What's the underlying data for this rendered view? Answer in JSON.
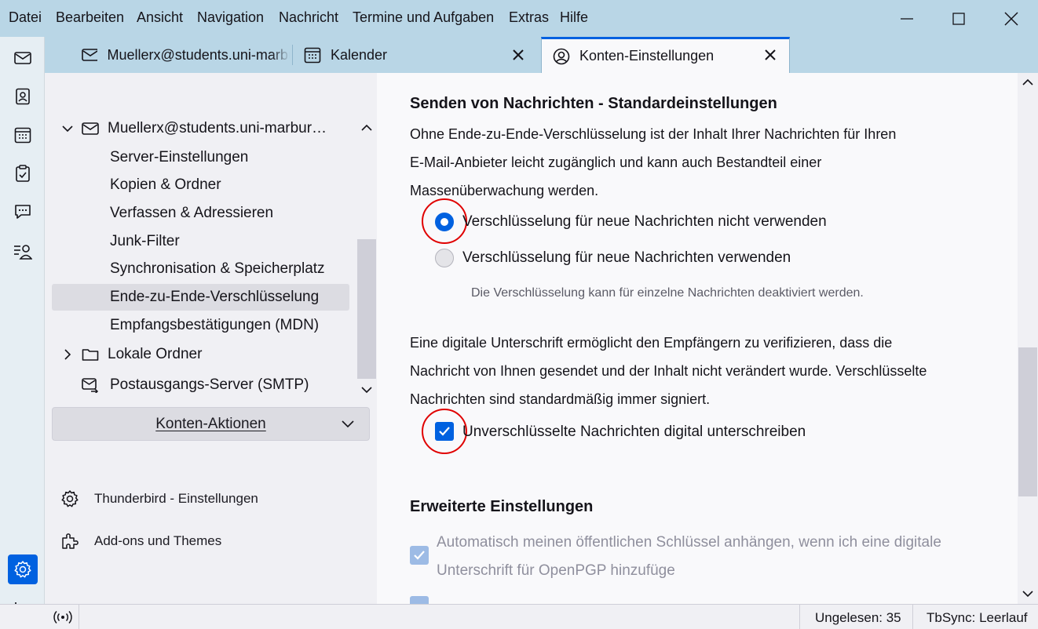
{
  "menubar": {
    "items": [
      "Datei",
      "Bearbeiten",
      "Ansicht",
      "Navigation",
      "Nachricht",
      "Termine und Aufgaben",
      "Extras",
      "Hilfe"
    ]
  },
  "tabs": [
    {
      "label": "Muellerx@students.uni-marburg",
      "icon": "mail-account-icon"
    },
    {
      "label": "Kalender",
      "icon": "calendar-icon"
    },
    {
      "label": "Konten-Einstellungen",
      "icon": "account-settings-icon"
    }
  ],
  "spaces": [
    "mail-icon",
    "address-book-icon",
    "calendar-icon",
    "tasks-icon",
    "chat-icon",
    "tbsync-icon",
    "settings-icon",
    "collapse-icon"
  ],
  "sidebar": {
    "account": "Muellerx@students.uni-marbur…",
    "items": [
      "Server-Einstellungen",
      "Kopien & Ordner",
      "Verfassen & Adressieren",
      "Junk-Filter",
      "Synchronisation & Speicherplatz",
      "Ende-zu-Ende-Verschlüsselung",
      "Empfangsbestätigungen (MDN)"
    ],
    "local_folders": "Lokale Ordner",
    "smtp": "Postausgangs-Server (SMTP)",
    "account_actions": "Konten-Aktionen",
    "settings_link": "Thunderbird - Einstellungen",
    "addons_link": "Add-ons und Themes"
  },
  "content": {
    "section1_title": "Senden von Nachrichten - Standardeinstellungen",
    "section1_text_1": "Ohne Ende-zu-Ende-Verschlüsselung ist der Inhalt Ihrer Nachrichten für Ihren",
    "section1_text_2": "E-Mail-Anbieter leicht zugänglich und kann auch Bestandteil einer",
    "section1_text_3": "Massenüberwachung werden.",
    "radio_no_encryption": "Verschlüsselung für neue Nachrichten nicht verwenden",
    "radio_encryption": "Verschlüsselung für neue Nachrichten verwenden",
    "radio_note": "Die Verschlüsselung kann für einzelne Nachrichten deaktiviert werden.",
    "sign_text_1": "Eine digitale Unterschrift ermöglicht den Empfängern zu verifizieren, dass die",
    "sign_text_2": "Nachricht von Ihnen gesendet und der Inhalt nicht verändert wurde. Verschlüsselte",
    "sign_text_3": "Nachrichten sind standardmäßig immer signiert.",
    "checkbox_sign": "Unverschlüsselte Nachrichten digital unterschreiben",
    "section2_title": "Erweiterte Einstellungen",
    "checkbox_attach_key_1": "Automatisch meinen öffentlichen Schlüssel anhängen, wenn ich eine digitale",
    "checkbox_attach_key_2": "Unterschrift für OpenPGP hinzufüge"
  },
  "statusbar": {
    "unread": "Ungelesen: 35",
    "tbsync": "TbSync: Leerlauf"
  },
  "colors": {
    "accent": "#0061e0",
    "highlight_circle": "#e00000",
    "menubar": "#b9d6e6"
  }
}
